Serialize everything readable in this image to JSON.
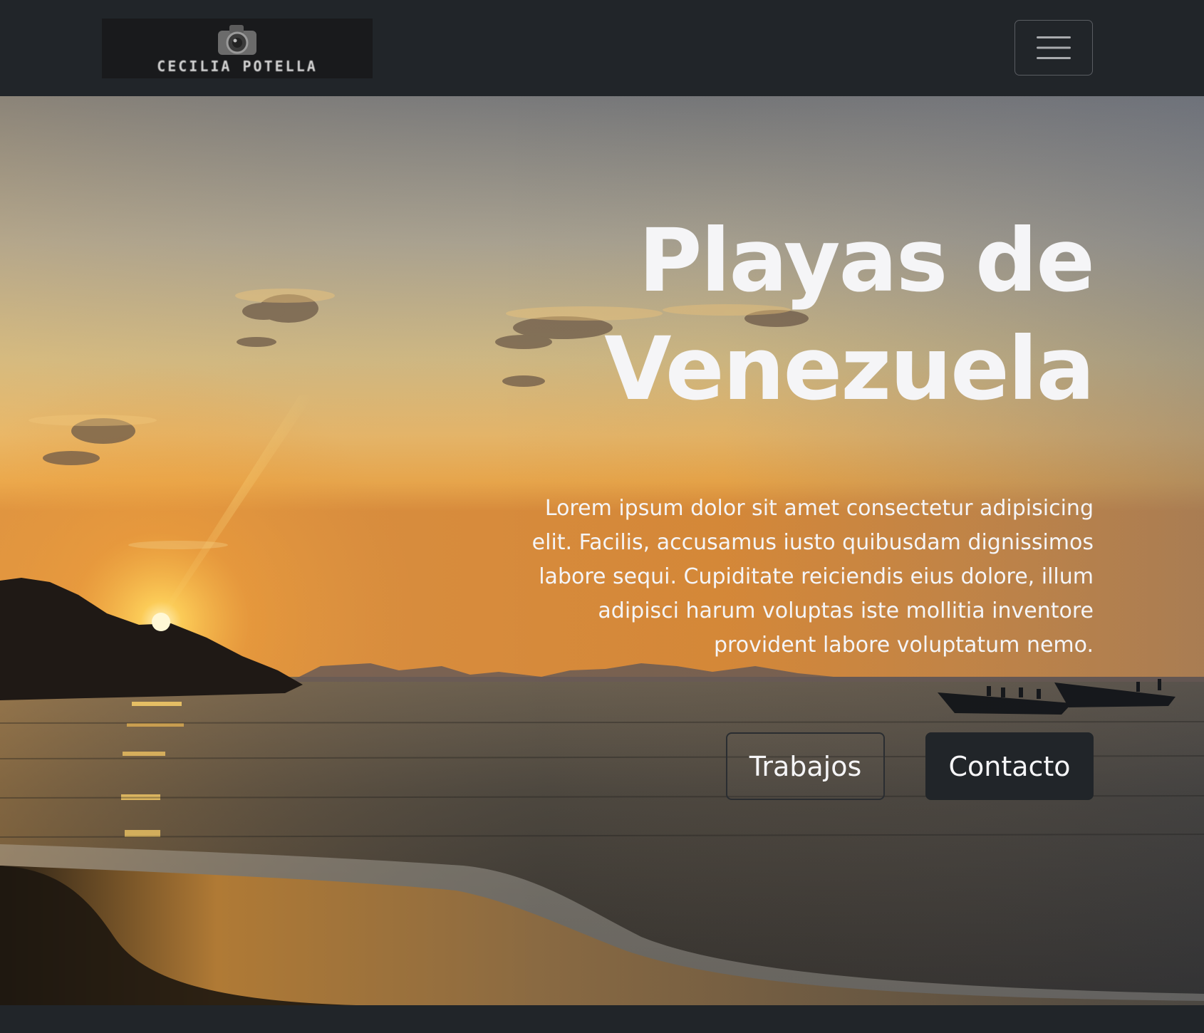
{
  "navbar": {
    "logo_text": "CECILIA POTELLA",
    "logo_icon": "camera-icon",
    "toggler_icon": "hamburger-icon"
  },
  "hero": {
    "title_line1": "Playas de",
    "title_line2": "Venezuela",
    "text": "Lorem ipsum dolor sit amet consectetur adipisicing elit. Facilis, accusamus iusto quibusdam dignissimos labore sequi. Cupiditate reiciendis eius dolore, illum adipisci harum voluptas iste mollitia inventore provident labore voluptatum nemo.",
    "button_works": "Trabajos",
    "button_contact": "Contacto"
  },
  "colors": {
    "navbar_bg": "#212529",
    "text": "#f5f5f7",
    "button_dark": "#212529"
  }
}
